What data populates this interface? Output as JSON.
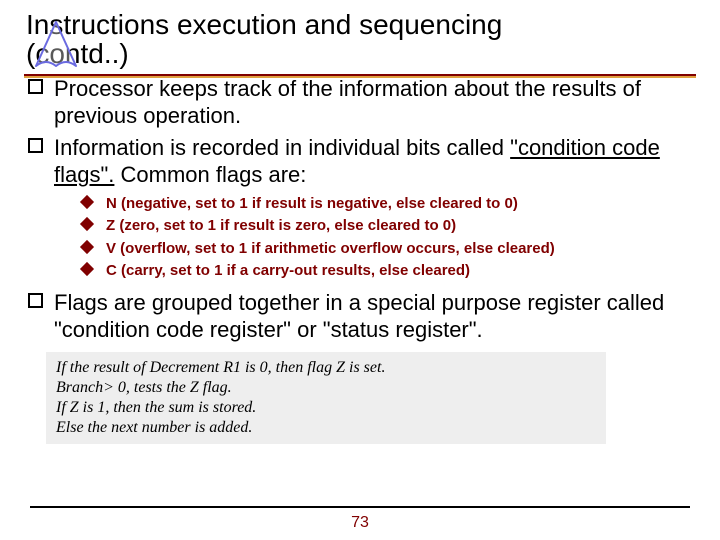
{
  "title_line1": "Instructions execution and sequencing",
  "title_line2": "(contd..)",
  "bullets": {
    "b0a": "Processor keeps track of the information about the",
    "b0b": "results of previous operation.",
    "b1a": "Information is recorded in individual bits called",
    "b1b_cc": "\"condition code flags\".",
    "b1b_rest": " Common flags are:",
    "sub0": "N (negative, set to 1 if result is negative, else cleared to 0)",
    "sub1": "Z (zero, set to 1 if result is zero, else cleared to 0)",
    "sub2": "V (overflow, set to 1 if arithmetic overflow occurs, else cleared)",
    "sub3": "C (carry, set to 1 if a carry-out results, else cleared)",
    "b2a": "Flags are grouped together in a special purpose",
    "b2b": "register called \"condition code register\" or \"status",
    "b2c": "register\"."
  },
  "note": {
    "l0": "If the result of Decrement R1 is 0, then flag Z is set.",
    "l1": "Branch> 0, tests the Z flag.",
    "l2": "If Z is 1, then the sum is stored.",
    "l3": "Else the next number is added."
  },
  "page_number": "73"
}
